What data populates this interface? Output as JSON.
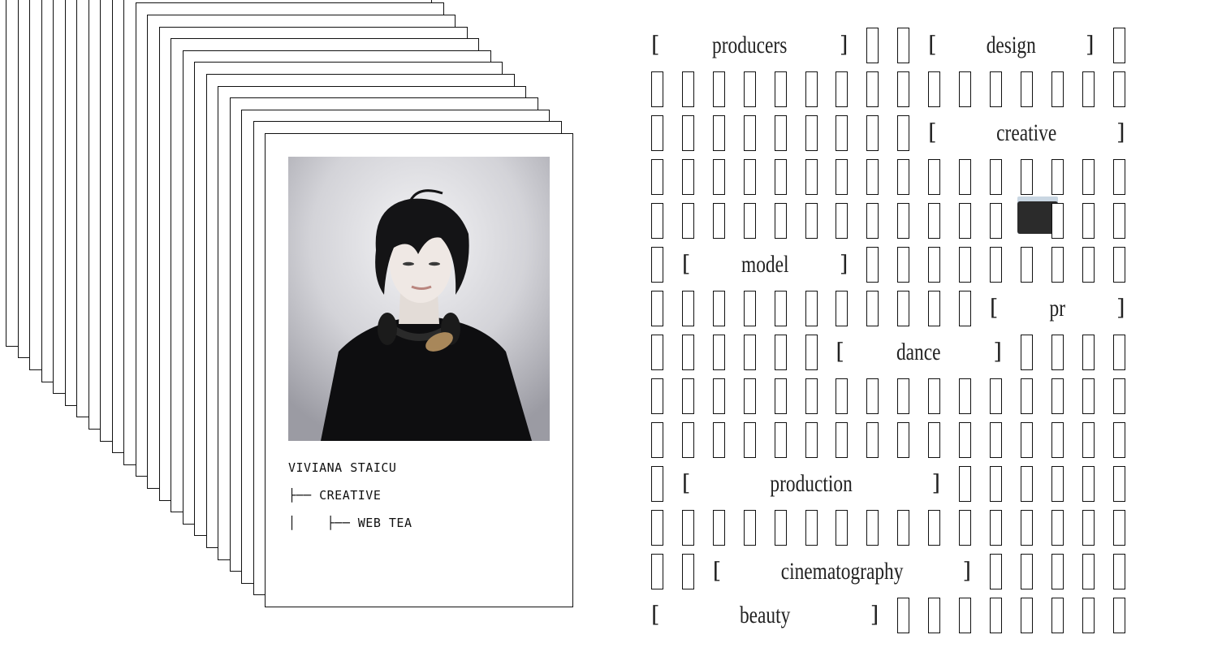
{
  "profile": {
    "name": "VIVIANA STAICU",
    "branch_1": "├── CREATIVE",
    "branch_2": "│    ├── WEB TEA"
  },
  "grid": {
    "rows": [
      [
        {
          "label": "producers",
          "span": 7
        },
        {
          "cell": 1
        },
        {
          "cell": 1
        },
        {
          "label": "design",
          "span": 6
        },
        {
          "cell": 1
        }
      ],
      [
        {
          "cell": 16
        }
      ],
      [
        {
          "cell": 9
        },
        {
          "label": "creative",
          "span": 7
        }
      ],
      [
        {
          "cell": 16
        }
      ],
      [
        {
          "cell": 12
        },
        {
          "active": 1
        },
        {
          "cell": 3
        }
      ],
      [
        {
          "cell": 1
        },
        {
          "label": "model",
          "span": 6
        },
        {
          "cell": 9
        }
      ],
      [
        {
          "cell": 11
        },
        {
          "label": "pr",
          "span": 5
        }
      ],
      [
        {
          "cell": 6
        },
        {
          "label": "dance",
          "span": 6
        },
        {
          "cell": 4
        }
      ],
      [
        {
          "cell": 16
        }
      ],
      [
        {
          "cell": 16
        }
      ],
      [
        {
          "cell": 1
        },
        {
          "label": "production",
          "span": 9
        },
        {
          "cell": 6
        }
      ],
      [
        {
          "cell": 16
        }
      ],
      [
        {
          "cell": 2
        },
        {
          "label": "cinematography",
          "span": 9
        },
        {
          "cell": 5
        }
      ],
      [
        {
          "label": "beauty",
          "span": 8
        },
        {
          "cell": 8
        }
      ]
    ]
  }
}
